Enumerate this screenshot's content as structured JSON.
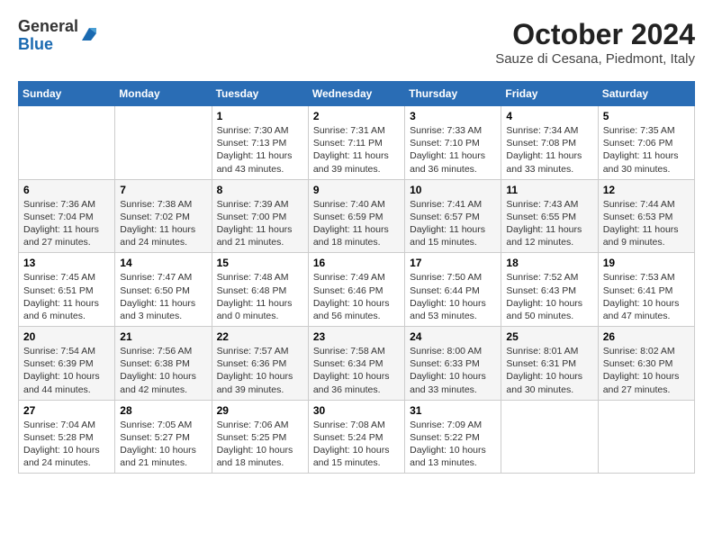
{
  "header": {
    "logo": {
      "line1": "General",
      "line2": "Blue"
    },
    "title": "October 2024",
    "subtitle": "Sauze di Cesana, Piedmont, Italy"
  },
  "weekdays": [
    "Sunday",
    "Monday",
    "Tuesday",
    "Wednesday",
    "Thursday",
    "Friday",
    "Saturday"
  ],
  "weeks": [
    [
      {
        "day": null
      },
      {
        "day": null
      },
      {
        "day": "1",
        "sunrise": "7:30 AM",
        "sunset": "7:13 PM",
        "daylight": "11 hours and 43 minutes."
      },
      {
        "day": "2",
        "sunrise": "7:31 AM",
        "sunset": "7:11 PM",
        "daylight": "11 hours and 39 minutes."
      },
      {
        "day": "3",
        "sunrise": "7:33 AM",
        "sunset": "7:10 PM",
        "daylight": "11 hours and 36 minutes."
      },
      {
        "day": "4",
        "sunrise": "7:34 AM",
        "sunset": "7:08 PM",
        "daylight": "11 hours and 33 minutes."
      },
      {
        "day": "5",
        "sunrise": "7:35 AM",
        "sunset": "7:06 PM",
        "daylight": "11 hours and 30 minutes."
      }
    ],
    [
      {
        "day": "6",
        "sunrise": "7:36 AM",
        "sunset": "7:04 PM",
        "daylight": "11 hours and 27 minutes."
      },
      {
        "day": "7",
        "sunrise": "7:38 AM",
        "sunset": "7:02 PM",
        "daylight": "11 hours and 24 minutes."
      },
      {
        "day": "8",
        "sunrise": "7:39 AM",
        "sunset": "7:00 PM",
        "daylight": "11 hours and 21 minutes."
      },
      {
        "day": "9",
        "sunrise": "7:40 AM",
        "sunset": "6:59 PM",
        "daylight": "11 hours and 18 minutes."
      },
      {
        "day": "10",
        "sunrise": "7:41 AM",
        "sunset": "6:57 PM",
        "daylight": "11 hours and 15 minutes."
      },
      {
        "day": "11",
        "sunrise": "7:43 AM",
        "sunset": "6:55 PM",
        "daylight": "11 hours and 12 minutes."
      },
      {
        "day": "12",
        "sunrise": "7:44 AM",
        "sunset": "6:53 PM",
        "daylight": "11 hours and 9 minutes."
      }
    ],
    [
      {
        "day": "13",
        "sunrise": "7:45 AM",
        "sunset": "6:51 PM",
        "daylight": "11 hours and 6 minutes."
      },
      {
        "day": "14",
        "sunrise": "7:47 AM",
        "sunset": "6:50 PM",
        "daylight": "11 hours and 3 minutes."
      },
      {
        "day": "15",
        "sunrise": "7:48 AM",
        "sunset": "6:48 PM",
        "daylight": "11 hours and 0 minutes."
      },
      {
        "day": "16",
        "sunrise": "7:49 AM",
        "sunset": "6:46 PM",
        "daylight": "10 hours and 56 minutes."
      },
      {
        "day": "17",
        "sunrise": "7:50 AM",
        "sunset": "6:44 PM",
        "daylight": "10 hours and 53 minutes."
      },
      {
        "day": "18",
        "sunrise": "7:52 AM",
        "sunset": "6:43 PM",
        "daylight": "10 hours and 50 minutes."
      },
      {
        "day": "19",
        "sunrise": "7:53 AM",
        "sunset": "6:41 PM",
        "daylight": "10 hours and 47 minutes."
      }
    ],
    [
      {
        "day": "20",
        "sunrise": "7:54 AM",
        "sunset": "6:39 PM",
        "daylight": "10 hours and 44 minutes."
      },
      {
        "day": "21",
        "sunrise": "7:56 AM",
        "sunset": "6:38 PM",
        "daylight": "10 hours and 42 minutes."
      },
      {
        "day": "22",
        "sunrise": "7:57 AM",
        "sunset": "6:36 PM",
        "daylight": "10 hours and 39 minutes."
      },
      {
        "day": "23",
        "sunrise": "7:58 AM",
        "sunset": "6:34 PM",
        "daylight": "10 hours and 36 minutes."
      },
      {
        "day": "24",
        "sunrise": "8:00 AM",
        "sunset": "6:33 PM",
        "daylight": "10 hours and 33 minutes."
      },
      {
        "day": "25",
        "sunrise": "8:01 AM",
        "sunset": "6:31 PM",
        "daylight": "10 hours and 30 minutes."
      },
      {
        "day": "26",
        "sunrise": "8:02 AM",
        "sunset": "6:30 PM",
        "daylight": "10 hours and 27 minutes."
      }
    ],
    [
      {
        "day": "27",
        "sunrise": "7:04 AM",
        "sunset": "5:28 PM",
        "daylight": "10 hours and 24 minutes."
      },
      {
        "day": "28",
        "sunrise": "7:05 AM",
        "sunset": "5:27 PM",
        "daylight": "10 hours and 21 minutes."
      },
      {
        "day": "29",
        "sunrise": "7:06 AM",
        "sunset": "5:25 PM",
        "daylight": "10 hours and 18 minutes."
      },
      {
        "day": "30",
        "sunrise": "7:08 AM",
        "sunset": "5:24 PM",
        "daylight": "10 hours and 15 minutes."
      },
      {
        "day": "31",
        "sunrise": "7:09 AM",
        "sunset": "5:22 PM",
        "daylight": "10 hours and 13 minutes."
      },
      {
        "day": null
      },
      {
        "day": null
      }
    ]
  ],
  "labels": {
    "sunrise": "Sunrise:",
    "sunset": "Sunset:",
    "daylight": "Daylight:"
  }
}
